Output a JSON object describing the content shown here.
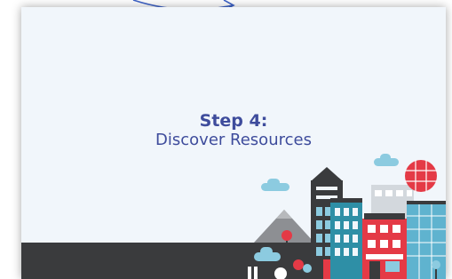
{
  "slide": {
    "title_line1": "Step 4:",
    "title_line2": "Discover Resources"
  },
  "colors": {
    "slide_bg": "#f1f6fb",
    "title": "#3e4c9c",
    "ground": "#3a3b3d",
    "accent_red": "#e43a46",
    "accent_teal": "#2e8fa6",
    "sky_cloud": "#8ccbe0",
    "arrow": "#3f64c8"
  },
  "icons": [
    "arrow-pointer-icon",
    "cityscape-illustration"
  ]
}
